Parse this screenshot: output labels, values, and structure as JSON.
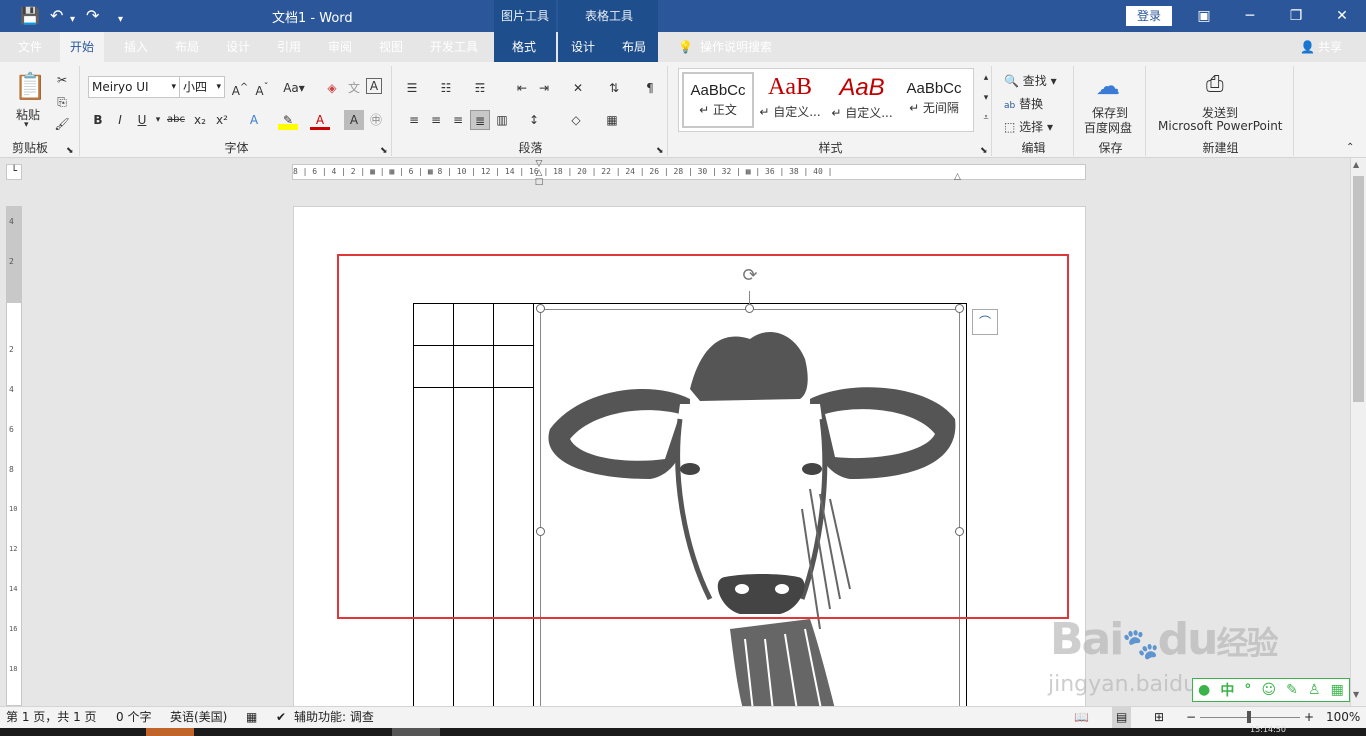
{
  "window": {
    "title": "文档1  -  Word",
    "context_tab_picture": "图片工具",
    "context_tab_table": "表格工具",
    "login": "登录",
    "share": "共享"
  },
  "quick_access": {
    "save": "💾",
    "undo": "↶",
    "undo_dd": "▾",
    "redo": "↷",
    "customize": "▾"
  },
  "tabs": [
    "文件",
    "开始",
    "插入",
    "布局",
    "设计",
    "引用",
    "审阅",
    "视图",
    "开发工具",
    "格式",
    "设计",
    "布局"
  ],
  "tell_me": "操作说明搜索",
  "ribbon": {
    "clipboard": {
      "label": "剪贴板",
      "paste": "粘贴"
    },
    "font": {
      "label": "字体",
      "name": "Meiryo UI",
      "size": "小四",
      "aa": "Aa",
      "b": "B",
      "i": "I",
      "u": "U",
      "abc": "abc",
      "x2": "x₂",
      "x2sup": "x²",
      "A": "A"
    },
    "paragraph": {
      "label": "段落"
    },
    "styles": {
      "label": "样式",
      "items": [
        {
          "sample": "AaBbCc",
          "name": "↵ 正文",
          "color": "#000000"
        },
        {
          "sample": "AaB",
          "name": "↵ 自定义...",
          "color": "#c00000"
        },
        {
          "sample": "AaB",
          "name": "↵ 自定义...",
          "color": "#c00000"
        },
        {
          "sample": "AaBbCc",
          "name": "↵ 无间隔",
          "color": "#000000"
        }
      ]
    },
    "editing": {
      "label": "编辑",
      "find": "查找",
      "replace": "替换",
      "select": "选择"
    },
    "save": {
      "label": "保存",
      "button": "保存到",
      "button2": "百度网盘"
    },
    "newgroup": {
      "label": "新建组",
      "button": "发送到",
      "button2": "Microsoft PowerPoint"
    }
  },
  "ruler": {
    "h_text": "8 | 6 | 4 | 2 | ▦ | ▦ | 6 | ▦ 8 | 10 | 12 | 14 | 16 | 18 | 20 | 22 | 24 | 26 | 28 | 30 | 32 | ▦ | 36 | 38 | 40 |",
    "v_ticks": [
      "4",
      "2",
      "2",
      "4",
      "6",
      "8",
      "10",
      "12",
      "14",
      "16",
      "18"
    ]
  },
  "status": {
    "page": "第 1 页，共 1 页",
    "words": "0 个字",
    "lang": "英语(美国)",
    "accessibility": "辅助功能: 调查",
    "zoom": "100%"
  },
  "watermark": {
    "brand": "Bai",
    "du": "du",
    "jy": "经验",
    "url": "jingyan.baidu.com"
  },
  "ime": {
    "items": [
      "中",
      "°",
      "☺",
      "✎",
      "♙",
      "▦"
    ]
  },
  "clock": "15:14:50"
}
